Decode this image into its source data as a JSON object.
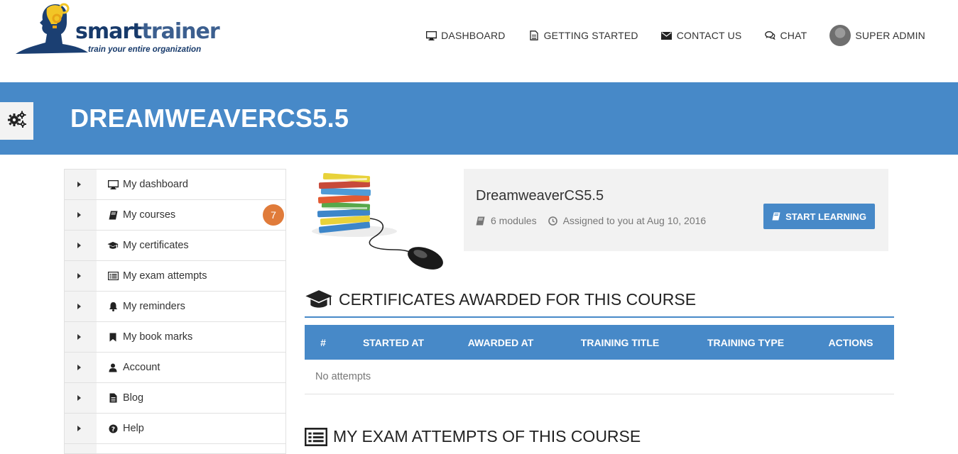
{
  "logo": {
    "word_part1": "smart",
    "word_part2": "trainer",
    "tagline": "train your entire organization"
  },
  "nav": {
    "items": [
      {
        "label": "DASHBOARD",
        "icon": "desktop-icon"
      },
      {
        "label": "GETTING STARTED",
        "icon": "document-icon"
      },
      {
        "label": "CONTACT US",
        "icon": "envelope-icon"
      },
      {
        "label": "CHAT",
        "icon": "chat-bubbles-icon"
      }
    ],
    "user": {
      "label": "SUPER ADMIN",
      "icon": "avatar"
    }
  },
  "banner": {
    "title": "DREAMWEAVERCS5.5",
    "settings_icon": "gears-icon",
    "color": "#4789c8"
  },
  "sidebar": {
    "items": [
      {
        "label": "My dashboard",
        "icon": "desktop-icon"
      },
      {
        "label": "My courses",
        "icon": "book-icon",
        "badge": "7"
      },
      {
        "label": "My certificates",
        "icon": "graduation-cap-icon"
      },
      {
        "label": "My exam attempts",
        "icon": "list-icon"
      },
      {
        "label": "My reminders",
        "icon": "bell-icon"
      },
      {
        "label": "My book marks",
        "icon": "bookmark-icon"
      },
      {
        "label": "Account",
        "icon": "user-icon"
      },
      {
        "label": "Blog",
        "icon": "file-text-icon"
      },
      {
        "label": "Help",
        "icon": "question-circle-icon"
      }
    ]
  },
  "course": {
    "name": "DreamweaverCS5.5",
    "modules": "6 modules",
    "assigned": "Assigned to you at Aug 10, 2016",
    "start_label": "START LEARNING",
    "image": "books-and-mouse-image"
  },
  "certificates": {
    "title": "CERTIFICATES AWARDED FOR THIS COURSE",
    "columns": [
      "#",
      "STARTED AT",
      "AWARDED AT",
      "TRAINING TITLE",
      "TRAINING TYPE",
      "ACTIONS"
    ],
    "empty_text": "No attempts"
  },
  "exams": {
    "title": "MY EXAM ATTEMPTS OF THIS COURSE"
  },
  "colors": {
    "primary": "#4789c8",
    "badge": "#e07b3a",
    "card": "#f2f2f2"
  }
}
